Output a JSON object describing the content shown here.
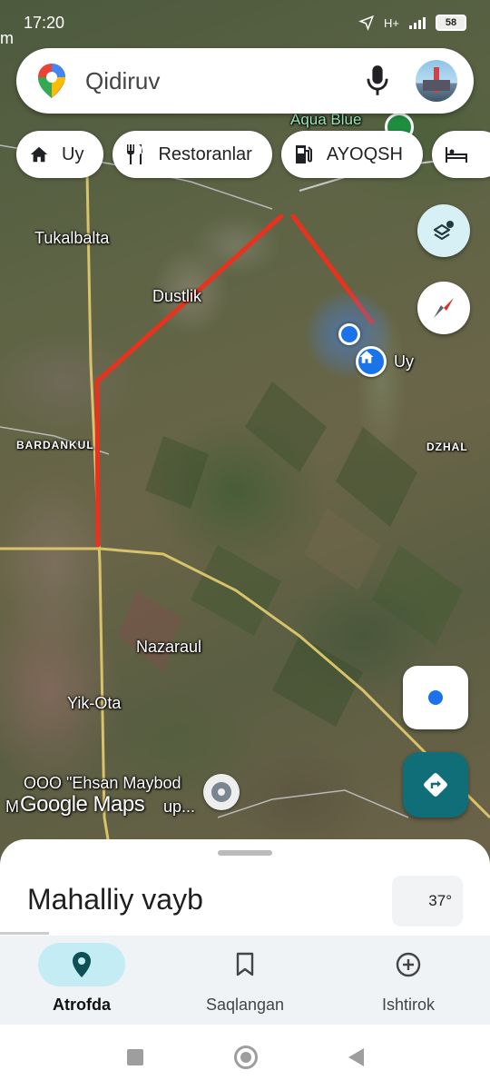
{
  "status_bar": {
    "time": "17:20",
    "network": "H+",
    "battery": "58",
    "edge_char": "m"
  },
  "search": {
    "placeholder": "Qidiruv"
  },
  "chips": [
    {
      "icon": "home-icon",
      "label": "Uy"
    },
    {
      "icon": "restaurant-icon",
      "label": "Restoranlar"
    },
    {
      "icon": "gas-station-icon",
      "label": "AYOQSH"
    },
    {
      "icon": "hotel-icon",
      "label": ""
    }
  ],
  "map": {
    "labels": {
      "aqua_blue": "Aqua Blue",
      "tukalbalta": "Tukalbalta",
      "dustlik": "Dustlik",
      "home_label": "Uy",
      "bardankul": "BARDANKUL",
      "dzhal": "DZHAL",
      "nazaraul": "Nazaraul",
      "yik_ota": "Yik-Ota",
      "poi_line1": "OOO \"Ehsan Maybod",
      "poi_line2": "M",
      "poi_line3": "up...",
      "google_logo": "Google Maps"
    },
    "route_color": "#e8321e",
    "location_color": "#1a73e8"
  },
  "sheet": {
    "title": "Mahalliy vayb",
    "temperature": "37°"
  },
  "bottom_nav": [
    {
      "icon": "location-pin-icon",
      "label": "Atrofda",
      "active": true
    },
    {
      "icon": "bookmark-icon",
      "label": "Saqlangan",
      "active": false
    },
    {
      "icon": "add-circle-icon",
      "label": "Ishtirok",
      "active": false
    }
  ],
  "colors": {
    "accent": "#0f6e78",
    "active_nav_bg": "#c4ecf5"
  }
}
